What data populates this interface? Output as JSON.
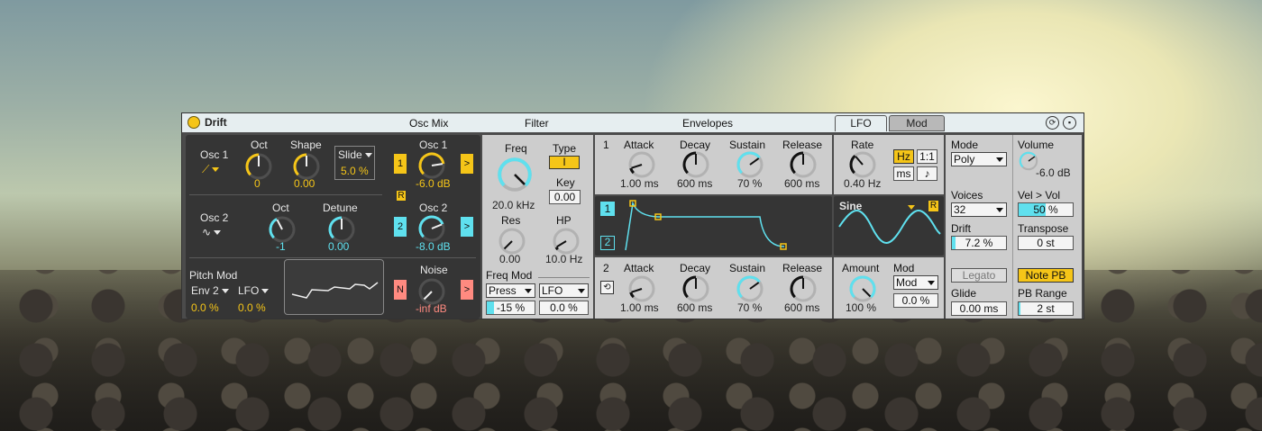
{
  "device": {
    "name": "Drift"
  },
  "sections": {
    "osc_mix": "Osc Mix",
    "filter": "Filter",
    "envelopes": "Envelopes"
  },
  "tabs": {
    "lfo": "LFO",
    "mod": "Mod"
  },
  "osc1": {
    "label": "Osc 1",
    "oct_label": "Oct",
    "oct_value": "0",
    "shape_label": "Shape",
    "shape_value": "0.00",
    "shape_mod_select": "Slide",
    "shape_mod_value": "5.0 %",
    "knob_oct": 0.5,
    "knob_shape": 0.5
  },
  "osc2": {
    "label": "Osc 2",
    "oct_label": "Oct",
    "oct_value": "-1",
    "detune_label": "Detune",
    "detune_value": "0.00",
    "knob_oct": 0.4,
    "knob_detune": 0.5
  },
  "mix": {
    "osc1_label": "Osc 1",
    "osc1_value": "-6.0 dB",
    "osc1_btn": "1",
    "osc2_label": "Osc 2",
    "osc2_value": "-8.0 dB",
    "osc2_btn": "2",
    "r_btn": "R",
    "noise_label": "Noise",
    "noise_value": "-inf dB",
    "noise_btn": "N",
    "arrow": ">",
    "knob_osc1": 0.8,
    "knob_osc2": 0.75,
    "knob_noise": 0.0
  },
  "pitch_mod": {
    "label": "Pitch Mod",
    "src1": "Env 2",
    "src2": "LFO",
    "amt1": "0.0 %",
    "amt2": "0.0 %"
  },
  "filter": {
    "freq_label": "Freq",
    "freq_value": "20.0 kHz",
    "type_label": "Type",
    "type_value": "I",
    "key_label": "Key",
    "key_value": "0.00",
    "res_label": "Res",
    "res_value": "0.00",
    "hp_label": "HP",
    "hp_value": "10.0 Hz",
    "freq_mod_label": "Freq Mod",
    "mod_src1": "Press",
    "mod_src2": "LFO",
    "mod_amt1": "-15 %",
    "mod_amt1_fill": 0.15,
    "mod_amt2": "0.0 %",
    "knob_freq": 1.0,
    "knob_res": 0.0,
    "knob_hp": 0.05
  },
  "env1": {
    "num": "1",
    "attack_label": "Attack",
    "attack_value": "1.00 ms",
    "decay_label": "Decay",
    "decay_value": "600 ms",
    "sustain_label": "Sustain",
    "sustain_value": "70 %",
    "release_label": "Release",
    "release_value": "600 ms",
    "knob_attack": 0.1,
    "knob_decay": 0.5,
    "knob_sustain": 0.7,
    "knob_release": 0.5
  },
  "env_display": {
    "btn1": "1",
    "btn2": "2"
  },
  "env2": {
    "num": "2",
    "attack_label": "Attack",
    "attack_value": "1.00 ms",
    "decay_label": "Decay",
    "decay_value": "600 ms",
    "sustain_label": "Sustain",
    "sustain_value": "70 %",
    "release_label": "Release",
    "release_value": "600 ms",
    "knob_attack": 0.1,
    "knob_decay": 0.5,
    "knob_sustain": 0.7,
    "knob_release": 0.5
  },
  "lfo": {
    "rate_label": "Rate",
    "rate_value": "0.40 Hz",
    "hz": "Hz",
    "ratio": "1:1",
    "ms": "ms",
    "note": "♪",
    "wave": "Sine",
    "r_btn": "R",
    "amount_label": "Amount",
    "amount_value": "100 %",
    "mod_label": "Mod",
    "mod_select": "Mod",
    "mod_value": "0.0 %",
    "knob_rate": 0.35,
    "knob_amount": 1.0
  },
  "global": {
    "mode_label": "Mode",
    "mode_value": "Poly",
    "voices_label": "Voices",
    "voices_value": "32",
    "drift_label": "Drift",
    "drift_value": "7.2 %",
    "drift_fill": 0.07,
    "legato": "Legato",
    "glide_label": "Glide",
    "glide_value": "0.00 ms",
    "volume_label": "Volume",
    "volume_value": "-6.0 dB",
    "knob_volume": 0.7,
    "velvol_label": "Vel > Vol",
    "velvol_value": "50 %",
    "velvol_fill": 0.5,
    "transpose_label": "Transpose",
    "transpose_value": "0 st",
    "note_pb": "Note PB",
    "pb_label": "PB Range",
    "pb_value": "2 st",
    "pb_fill": 0.04
  },
  "colors": {
    "accent_yellow": "#f5c518",
    "accent_cyan": "#5fe0ee",
    "accent_pink": "#ff8a80"
  }
}
